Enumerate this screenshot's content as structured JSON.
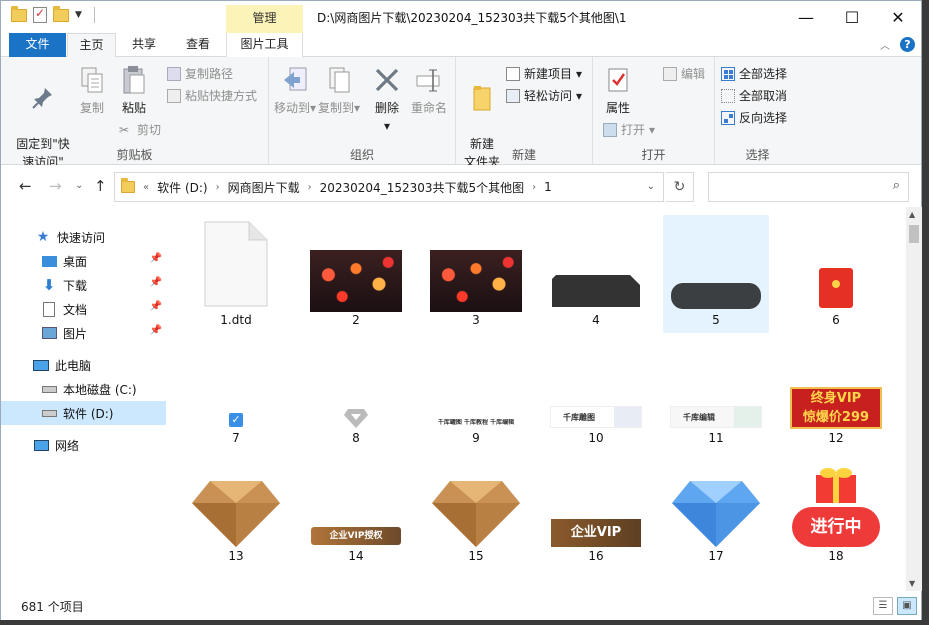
{
  "window": {
    "title_path": "D:\\网商图片下载\\20230204_152303共下载5个其他图\\1",
    "context_tab": "管理",
    "buttons": {
      "minimize": "—",
      "maximize": "☐",
      "close": "✕"
    }
  },
  "tabs": [
    "文件",
    "主页",
    "共享",
    "查看",
    "图片工具"
  ],
  "ribbon": {
    "clipboard": {
      "label": "剪贴板",
      "pin": "固定到\"快\n速访问\"",
      "copy": "复制",
      "paste": "粘贴",
      "copy_path": "复制路径",
      "paste_shortcut": "粘贴快捷方式",
      "cut": "剪切"
    },
    "organize": {
      "label": "组织",
      "move_to": "移动到",
      "copy_to": "复制到",
      "delete": "删除",
      "rename": "重命名"
    },
    "new": {
      "label": "新建",
      "new_folder": "新建\n文件夹",
      "new_item": "新建项目",
      "easy_access": "轻松访问"
    },
    "open": {
      "label": "打开",
      "properties": "属性",
      "open": "打开",
      "edit": "编辑"
    },
    "select": {
      "label": "选择",
      "select_all": "全部选择",
      "select_none": "全部取消",
      "invert": "反向选择"
    }
  },
  "address": {
    "chevron": "«",
    "crumbs": [
      "软件 (D:)",
      "网商图片下载",
      "20230204_152303共下载5个其他图",
      "1"
    ]
  },
  "nav": {
    "quick_access": "快速访问",
    "desktop": "桌面",
    "downloads": "下载",
    "documents": "文档",
    "pictures": "图片",
    "this_pc": "此电脑",
    "local_c": "本地磁盘 (C:)",
    "soft_d": "软件 (D:)",
    "network": "网络"
  },
  "files": [
    "1.dtd",
    "2",
    "3",
    "4",
    "5",
    "6",
    "7",
    "8",
    "9",
    "10",
    "11",
    "12",
    "13",
    "14",
    "15",
    "16",
    "17",
    "18"
  ],
  "thumb_text": {
    "t9": "千库罐图 千库教程 千库编辑",
    "t10": "千库雕图",
    "t11": "千库编辑",
    "t12_line1": "终身VIP",
    "t12_line2": "惊爆价299",
    "t14": "企业VIP授权",
    "t16": "企业VIP",
    "t18": "进行中"
  },
  "status": {
    "count": "681 个项目"
  },
  "colors": {
    "accent": "#1a73c5",
    "selection": "#cce8ff",
    "context_tab": "#fcf3b8"
  }
}
